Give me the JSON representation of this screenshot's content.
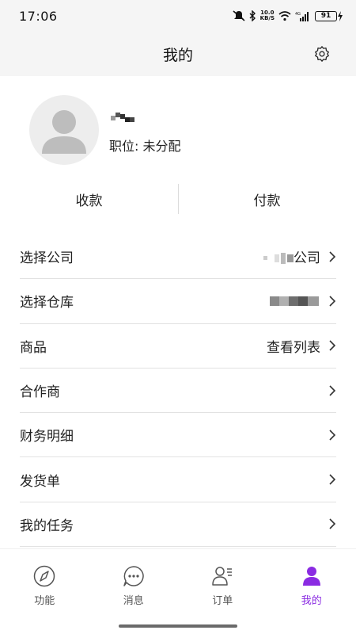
{
  "status_bar": {
    "time": "17:06",
    "speed_top": "10.0",
    "speed_bottom": "KB/S",
    "battery": "91",
    "network": "4G"
  },
  "header": {
    "title": "我的",
    "settings_icon": "gear-icon"
  },
  "profile": {
    "avatar_icon": "user-avatar-icon",
    "position_label": "职位: 未分配"
  },
  "payments": {
    "collect_label": "收款",
    "pay_label": "付款"
  },
  "menu": {
    "items": [
      {
        "label": "选择公司",
        "value": "公司"
      },
      {
        "label": "选择仓库",
        "value": ""
      },
      {
        "label": "商品",
        "value": "查看列表"
      },
      {
        "label": "合作商",
        "value": ""
      },
      {
        "label": "财务明细",
        "value": ""
      },
      {
        "label": "发货单",
        "value": ""
      },
      {
        "label": "我的任务",
        "value": ""
      }
    ]
  },
  "tabs": {
    "items": [
      {
        "label": "功能",
        "icon": "compass-icon"
      },
      {
        "label": "消息",
        "icon": "chat-bubble-icon"
      },
      {
        "label": "订单",
        "icon": "order-user-icon"
      },
      {
        "label": "我的",
        "icon": "person-icon"
      }
    ],
    "active_color": "#8a2be2"
  }
}
